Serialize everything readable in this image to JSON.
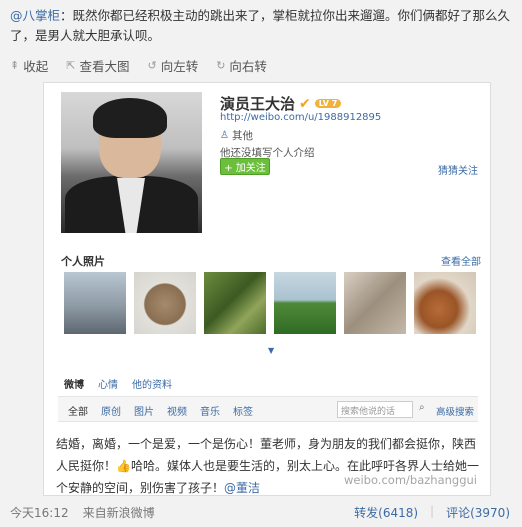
{
  "post": {
    "author": "@八掌柜",
    "text": "：既然你都已经积极主动的跳出来了，掌柜就拉你出来遛遛。你们俩都好了那么久了，是男人就大胆承认呗。"
  },
  "toolbar": {
    "collapse_label": "收起",
    "view_large_label": "查看大图",
    "rotate_left_label": "向左转",
    "rotate_right_label": "向右转"
  },
  "profile": {
    "name": "演员王大治",
    "level_badge": "LV 7",
    "url": "http://weibo.com/u/1988912895",
    "gender": "其他",
    "bio": "他还没填写个人介绍",
    "follow_label": "+ 加关注",
    "detail_link": "猜猜关注"
  },
  "photos": {
    "title": "个人照片",
    "more_label": "查看全部"
  },
  "tabs": [
    "微博",
    "心情",
    "他的资料"
  ],
  "subtabs": [
    "全部",
    "原创",
    "图片",
    "视频",
    "音乐",
    "标签"
  ],
  "search": {
    "placeholder": "搜索他说的话",
    "advanced_label": "高级搜索"
  },
  "weibo": {
    "text": "结婚，离婚，一个是爱，一个是伤心！董老师，身为朋友的我们都会挺你，陕西人民挺你！👍哈哈。媒体人也是要生活的，别太上心。在此呼吁各界人士给她一个安静的空间，别伤害了孩子！",
    "mention": "@董洁"
  },
  "watermark": "weibo.com/bazhanggui",
  "footer": {
    "time": "今天16:12",
    "source": "来自新浪微博",
    "repost": "转发(6418)",
    "comment": "评论(3970)"
  }
}
